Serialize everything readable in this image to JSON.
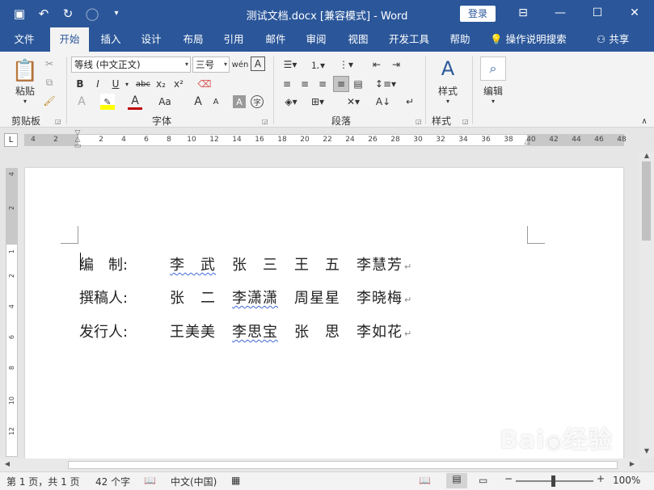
{
  "title_bar": {
    "doc_title": "测试文档.docx [兼容模式] - Word",
    "login_label": "登录",
    "qat_icons": [
      "save-icon",
      "undo-icon",
      "redo-icon",
      "touch-mode-icon",
      "customize-icon"
    ]
  },
  "tabs": [
    "文件",
    "开始",
    "插入",
    "设计",
    "布局",
    "引用",
    "邮件",
    "审阅",
    "视图",
    "开发工具",
    "帮助"
  ],
  "active_tab": "开始",
  "tell_me": "操作说明搜索",
  "share": "共享",
  "ribbon": {
    "clipboard": {
      "paste_label": "粘贴",
      "group_label": "剪贴板"
    },
    "font": {
      "font_name": "等线 (中文正文)",
      "font_size": "三号",
      "group_label": "字体",
      "format_buttons": [
        "B",
        "I",
        "U",
        "abc",
        "x₂",
        "x²"
      ],
      "size_buttons": [
        "A",
        "A",
        "Aa"
      ]
    },
    "paragraph": {
      "group_label": "段落"
    },
    "styles": {
      "button_label": "样式",
      "group_label": "样式"
    },
    "editing": {
      "button_label": "编辑"
    }
  },
  "ruler": {
    "left_numbers": [
      "4",
      "2"
    ],
    "main_numbers": [
      "2",
      "4",
      "6",
      "8",
      "10",
      "12",
      "14",
      "16",
      "18",
      "20",
      "22",
      "24",
      "26",
      "28",
      "30",
      "32",
      "34",
      "36",
      "38"
    ],
    "right_numbers": [
      "40",
      "42",
      "44",
      "46",
      "48"
    ],
    "vertical_numbers": [
      "4",
      "2",
      "1",
      "2",
      "4",
      "6",
      "8",
      "10",
      "12"
    ]
  },
  "document": {
    "lines": [
      {
        "label": "编　制:",
        "names": [
          "李　武",
          "张　三",
          "王　五",
          "李慧芳"
        ]
      },
      {
        "label": "撰稿人:",
        "names": [
          "张　二",
          "李潇潇",
          "周星星",
          "李晓梅"
        ]
      },
      {
        "label": "发行人:",
        "names": [
          "王美美",
          "李思宝",
          "张　思",
          "李如花"
        ]
      }
    ],
    "paragraph_mark": "↵"
  },
  "status_bar": {
    "page": "第 1 页，共 1 页",
    "words": "42 个字",
    "language": "中文(中国)",
    "zoom": "100%",
    "zoom_level": 1.0
  },
  "watermark": "Baidu 经验"
}
